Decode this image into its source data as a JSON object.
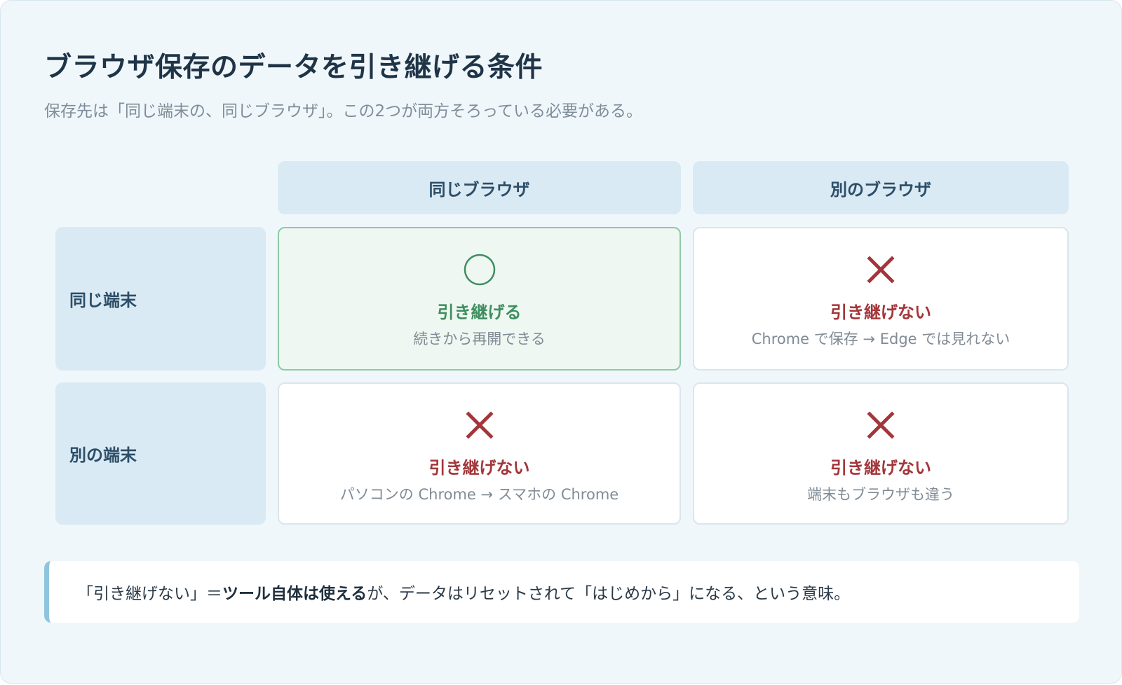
{
  "title": "ブラウザ保存のデータを引き継げる条件",
  "subtitle": "保存先は「同じ端末の、同じブラウザ」。この2つが両方そろっている必要がある。",
  "columns": [
    "同じブラウザ",
    "別のブラウザ"
  ],
  "rows": [
    "同じ端末",
    "別の端末"
  ],
  "cells": {
    "same_device_same_browser": {
      "icon": "circle-icon",
      "verdict": "引き継げる",
      "desc": "続きから再開できる"
    },
    "same_device_other_browser": {
      "icon": "cross-icon",
      "verdict": "引き継げない",
      "desc": "Chrome で保存 → Edge では見れない"
    },
    "other_device_same_browser": {
      "icon": "cross-icon",
      "verdict": "引き継げない",
      "desc": "パソコンの Chrome → スマホの Chrome"
    },
    "other_device_other_browser": {
      "icon": "cross-icon",
      "verdict": "引き継げない",
      "desc": "端末もブラウザも違う"
    }
  },
  "note": {
    "prefix": "「引き継げない」＝ ",
    "emphasis": "ツール自体は使える",
    "suffix": "が、データはリセットされて「はじめから」になる、という意味。"
  },
  "colors": {
    "ok": "#3f8e60",
    "ng": "#a3363a",
    "header_bg": "#d9eaf4",
    "accent_bar": "#8fc5dc"
  }
}
